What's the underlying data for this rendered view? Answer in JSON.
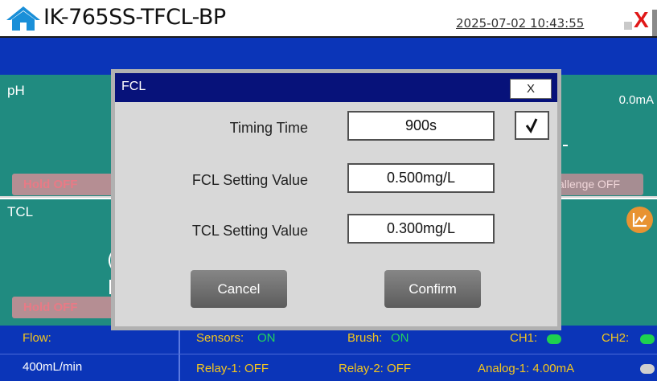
{
  "app": {
    "title": "IK-765SS-TFCL-BP",
    "datetime": "2025-07-02 10:43:55",
    "close_label": "X"
  },
  "panels": {
    "ph": {
      "label": "pH",
      "current": "0.0mA",
      "hold_label": "Hold OFF",
      "challenge_label": "allenge OFF"
    },
    "tcl": {
      "label": "TCL",
      "paren": "(",
      "hold_label": "Hold OFF"
    }
  },
  "status": {
    "flow_label": "Flow:",
    "flow_value": "400mL/min",
    "sensors_label": "Sensors:",
    "sensors_state": "ON",
    "brush_label": "Brush:",
    "brush_state": "ON",
    "ch1_label": "CH1:",
    "ch2_label": "CH2:",
    "relay1": "Relay-1: OFF",
    "relay2": "Relay-2: OFF",
    "analog1": "Analog-1: 4.00mA"
  },
  "dialog": {
    "title": "FCL",
    "close_label": "X",
    "fields": [
      {
        "label": "Timing Time",
        "value": "900s"
      },
      {
        "label": "FCL Setting Value",
        "value": "0.500mg/L"
      },
      {
        "label": "TCL Setting Value",
        "value": "0.300mg/L"
      }
    ],
    "timing_checked": true,
    "check_glyph": "✓",
    "cancel_label": "Cancel",
    "confirm_label": "Confirm"
  },
  "colors": {
    "header_blue": "#0b35b8",
    "panel_teal": "#208b80",
    "dialog_title": "#07127a",
    "close_red": "#e01818",
    "status_yellow": "#f5c61d",
    "status_green": "#24d45a",
    "led_green": "#1ed14f",
    "trend_orange": "#e89332",
    "hold_text": "#e87a86"
  }
}
